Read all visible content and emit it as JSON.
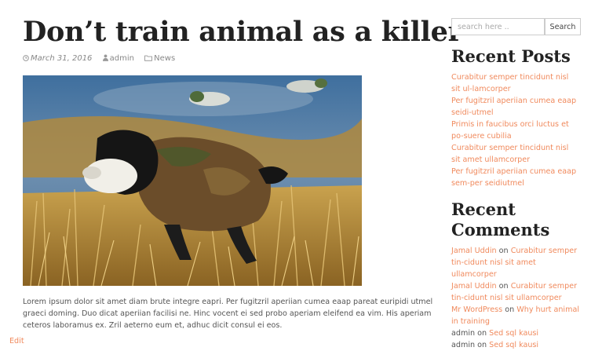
{
  "post": {
    "title": "Don’t train animal as a killer",
    "date": "March 31, 2016",
    "author": "admin",
    "category": "News",
    "excerpt": "Lorem ipsum dolor sit amet diam brute integre eapri. Per fugitzril aperiian cumea eaap pareat euripidi utmel graeci doming. Duo dicat aperiian facilisi ne. Hinc vocent ei sed probo aperiam eleifend ea vim. His aperiam ceteros laboramus ex. Zril aeterno eum et, adhuc dicit consul ei eos.",
    "edit_label": "Edit",
    "image_description_icon": "dog-retrieving-duck-image"
  },
  "search": {
    "placeholder": "search here ..",
    "button_label": "Search"
  },
  "recent_posts": {
    "title": "Recent Posts",
    "items": [
      "Curabitur semper tincidunt nisl sit ul-lamcorper",
      "Per fugitzril aperiian cumea eaap seidi-utmel",
      "Primis in faucibus orci luctus et po-suere cubilia",
      "Curabitur semper tincidunt nisl sit amet ullamcorper",
      "Per fugitzril aperiian cumea eaap sem-per seidiutmel"
    ]
  },
  "recent_comments": {
    "title": "Recent Comments",
    "items": [
      {
        "author": "Jamal Uddin",
        "author_link": true,
        "on": "on",
        "post": "Curabitur semper tin-cidunt nisl sit amet ullamcorper"
      },
      {
        "author": "Jamal Uddin",
        "author_link": true,
        "on": "on",
        "post": "Curabitur semper tin-cidunt nisl sit ullamcorper"
      },
      {
        "author": "Mr WordPress",
        "author_link": true,
        "on": "on",
        "post": "Why hurt animal in training"
      },
      {
        "author": "admin",
        "author_link": false,
        "on": "on",
        "post": "Sed sql kausi"
      },
      {
        "author": "admin",
        "author_link": false,
        "on": "on",
        "post": "Sed sql kausi"
      }
    ]
  },
  "colors": {
    "accent": "#f08a5d",
    "heading": "#222222",
    "text": "#555555"
  }
}
